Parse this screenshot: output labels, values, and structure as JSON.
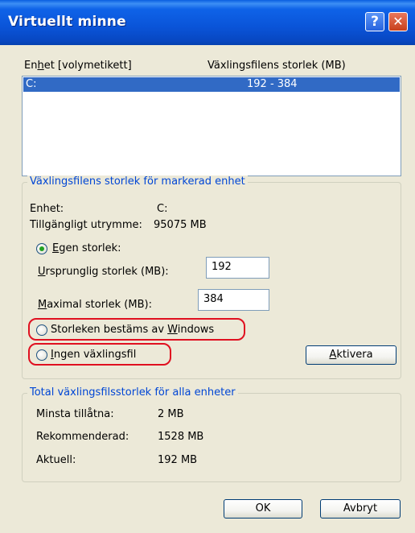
{
  "window": {
    "title": "Virtuellt minne",
    "help_glyph": "?",
    "close_glyph": "✕"
  },
  "drives": {
    "header_drive_pre": "En",
    "header_drive_mnemonic": "h",
    "header_drive_post": "et [volymetikett]",
    "header_size": "Växlingsfilens storlek (MB)",
    "rows": [
      {
        "drive": "C:",
        "size": "192 - 384"
      }
    ]
  },
  "selected_drive": {
    "group_title": "Växlingsfilens storlek för markerad enhet",
    "drive_label": "Enhet:",
    "drive_value": "C:",
    "space_label": "Tillgängligt utrymme:",
    "space_value": "95075 MB",
    "custom_pre": "",
    "custom_mnemonic": "E",
    "custom_post": "gen storlek:",
    "custom_checked": true,
    "initial_pre": "",
    "initial_mnemonic": "U",
    "initial_post": "rsprunglig storlek (MB):",
    "initial_value": "192",
    "max_pre": "",
    "max_mnemonic": "M",
    "max_post": "aximal storlek (MB):",
    "max_value": "384",
    "system_pre": "Storleken bestäms av ",
    "system_mnemonic": "W",
    "system_post": "indows",
    "nofile_pre": "",
    "nofile_mnemonic": "I",
    "nofile_post": "ngen växlingsfil",
    "set_pre": "",
    "set_mnemonic": "A",
    "set_post": "ktivera"
  },
  "totals": {
    "group_title": "Total växlingsfilsstorlek för alla enheter",
    "minimum_label": "Minsta tillåtna:",
    "minimum_value": "2 MB",
    "recommended_label": "Rekommenderad:",
    "recommended_value": "1528 MB",
    "current_label": "Aktuell:",
    "current_value": "192 MB"
  },
  "buttons": {
    "ok": "OK",
    "cancel": "Avbryt"
  },
  "colors": {
    "titlebar": "#0a54d8",
    "selection": "#316ac5",
    "group_title": "#0046d5",
    "highlight": "#e01020"
  }
}
